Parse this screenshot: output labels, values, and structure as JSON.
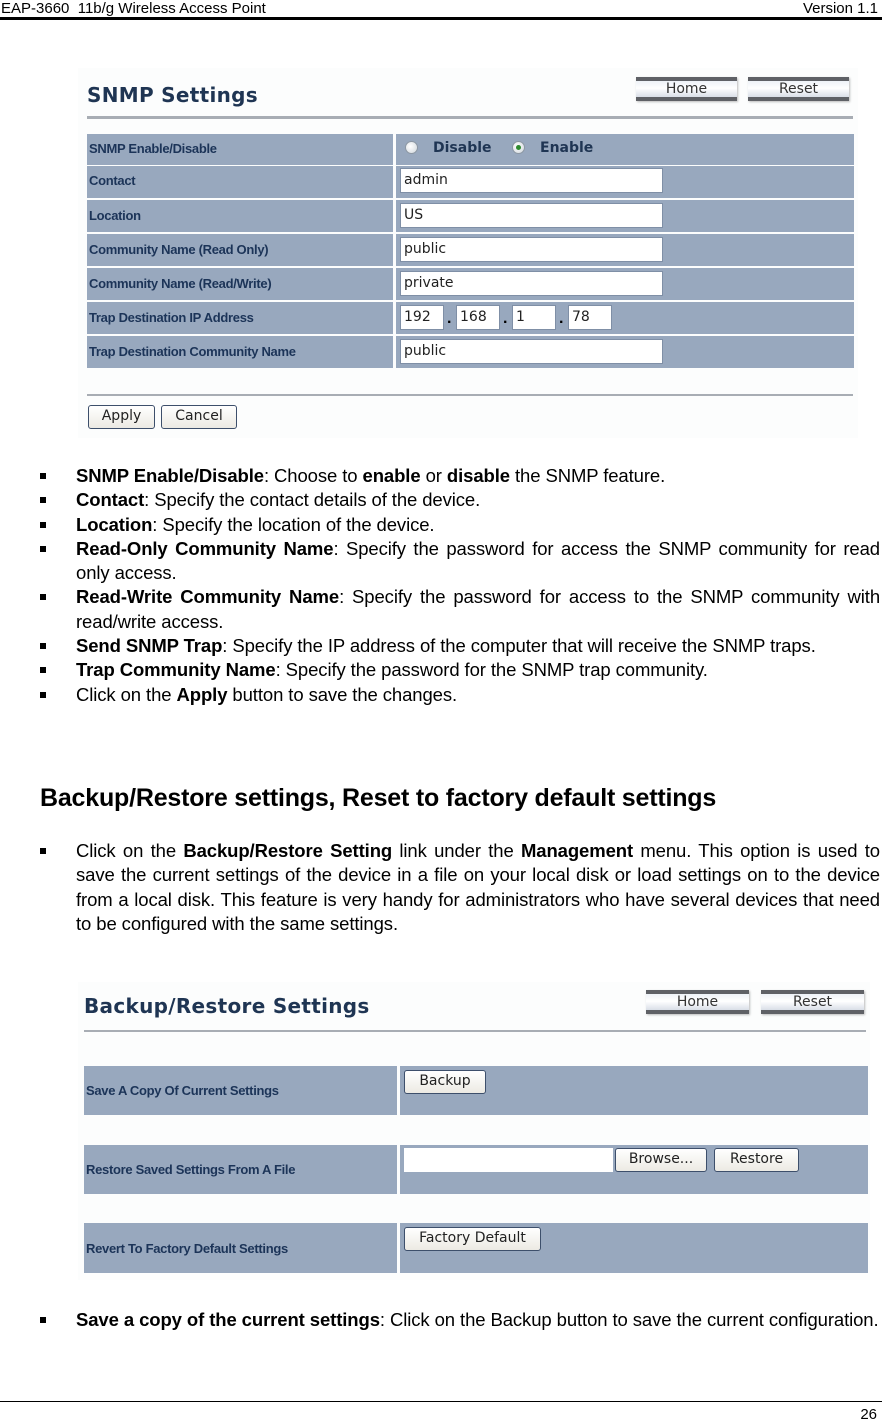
{
  "header": {
    "document_title": "EAP-3660  11b/g Wireless Access Point",
    "version": "Version 1.1"
  },
  "footer": {
    "page_number": "26"
  },
  "snmp_panel": {
    "title": "SNMP Settings",
    "nav": {
      "home_label": "Home",
      "reset_label": "Reset"
    },
    "rows": {
      "enable": {
        "label": "SNMP Enable/Disable",
        "options": [
          "Disable",
          "Enable"
        ],
        "selected": "Enable"
      },
      "contact": {
        "label": "Contact",
        "value": "admin"
      },
      "location": {
        "label": "Location",
        "value": "US"
      },
      "community_ro": {
        "label": "Community Name (Read Only)",
        "value": "public"
      },
      "community_rw": {
        "label": "Community Name (Read/Write)",
        "value": "private"
      },
      "trap_ip": {
        "label": "Trap Destination IP Address",
        "octets": [
          "192",
          "168",
          "1",
          "78"
        ]
      },
      "trap_community": {
        "label": "Trap Destination Community Name",
        "value": "public"
      }
    },
    "apply_label": "Apply",
    "cancel_label": "Cancel"
  },
  "snmp_bullets": [
    {
      "term": "SNMP Enable/Disable",
      "parts": [
        ": Choose to ",
        {
          "b": "enable"
        },
        " or ",
        {
          "b": "disable"
        },
        " the SNMP feature."
      ]
    },
    {
      "term": "Contact",
      "parts": [
        ": Specify the contact details of the device."
      ]
    },
    {
      "term": "Location",
      "parts": [
        ": Specify the location of the device."
      ]
    },
    {
      "term": "Read-Only Community Name",
      "parts": [
        ": Specify the password for access the SNMP community for read only access."
      ]
    },
    {
      "term": "Read-Write Community Name",
      "parts": [
        ": Specify the password for access to the SNMP community with read/write access."
      ]
    },
    {
      "term": "Send SNMP Trap",
      "parts": [
        ": Specify the IP address of the computer that will receive the SNMP traps."
      ]
    },
    {
      "term": "Trap Community Name",
      "parts": [
        ": Specify the password for the SNMP trap community."
      ]
    },
    {
      "term": "",
      "parts": [
        "Click on the ",
        {
          "b": "Apply"
        },
        " button to save the changes."
      ]
    }
  ],
  "section_heading": "Backup/Restore settings, Reset to factory default settings",
  "intro_bullets": [
    {
      "term": "",
      "parts": [
        "Click on the ",
        {
          "b": "Backup/Restore Setting"
        },
        " link under the ",
        {
          "b": "Management"
        },
        " menu. This option is used to save the current settings of the device in a file on your local disk or load settings on to the device from a local disk. This feature is very handy for administrators who have several devices that need to be configured with the same settings."
      ]
    }
  ],
  "backup_panel": {
    "title": "Backup/Restore Settings",
    "nav": {
      "home_label": "Home",
      "reset_label": "Reset"
    },
    "rows": {
      "save": {
        "label": "Save A Copy Of Current Settings",
        "button_label": "Backup"
      },
      "restore": {
        "label": "Restore Saved Settings From A File",
        "file_value": "",
        "browse_label": "Browse...",
        "button_label": "Restore"
      },
      "revert": {
        "label": "Revert To Factory Default Settings",
        "button_label": "Factory Default"
      }
    }
  },
  "backup_bullets": [
    {
      "term": "Save a copy of the current settings",
      "parts": [
        ": Click on the Backup button to save the current configuration."
      ]
    }
  ]
}
